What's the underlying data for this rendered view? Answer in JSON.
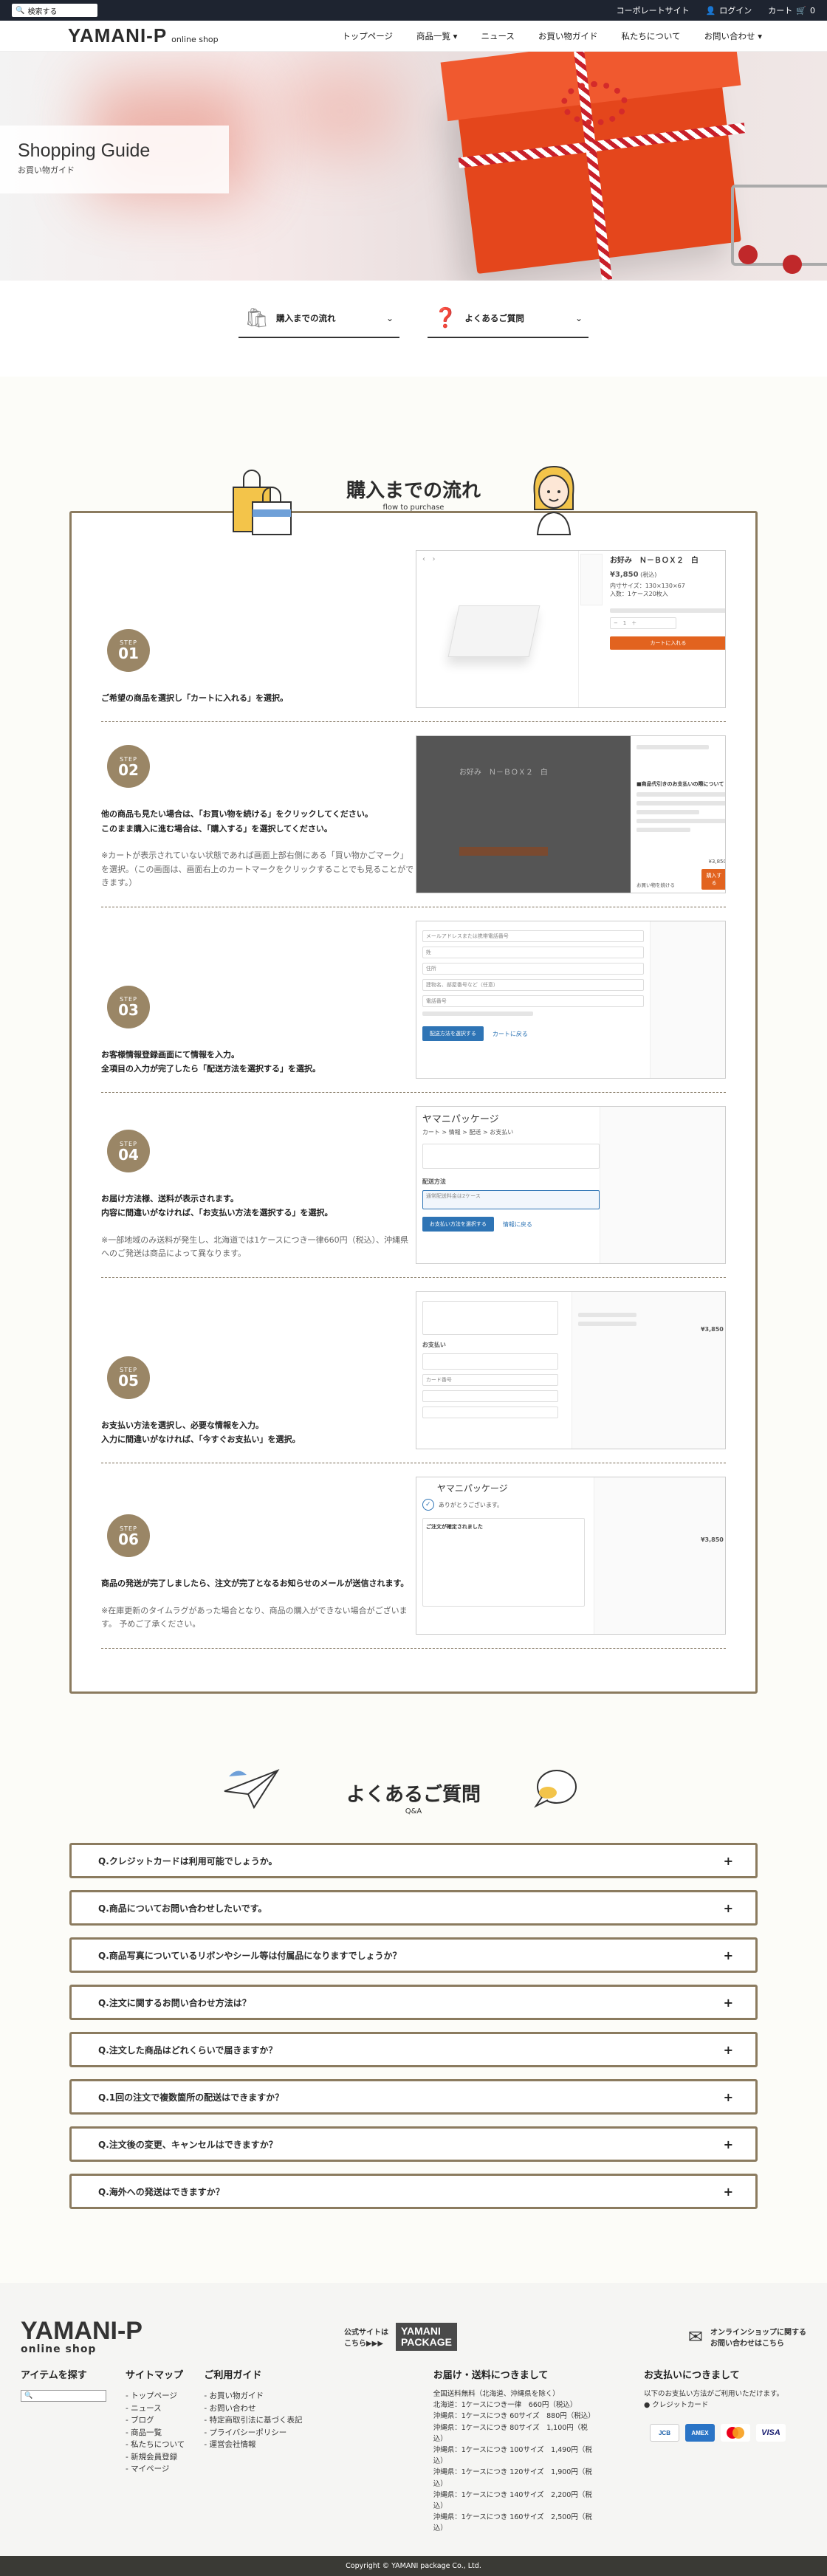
{
  "topbar": {
    "search_placeholder": "検索する",
    "corporate": "コーポレートサイト",
    "login": "ログイン",
    "cart": "カート",
    "cart_count": "0"
  },
  "header": {
    "logo": "YAMANI-P",
    "logo_sub": "online shop",
    "nav": [
      "トップページ",
      "商品一覧 ▾",
      "ニュース",
      "お買い物ガイド",
      "私たちについて",
      "お問い合わせ ▾"
    ]
  },
  "hero": {
    "title": "Shopping Guide",
    "subtitle": "お買い物ガイド"
  },
  "anchors": [
    {
      "label": "購入までの流れ"
    },
    {
      "label": "よくあるご質問"
    }
  ],
  "flow": {
    "title": "購入までの流れ",
    "title_en": "flow to purchase",
    "badge_step": "STEP",
    "steps": [
      {
        "num": "01",
        "text": "ご希望の商品を選択し「カートに入れる」を選択。",
        "note": ""
      },
      {
        "num": "02",
        "text": "他の商品も見たい場合は、「お買い物を続ける」をクリックしてください。\nこのまま購入に進む場合は、「購入する」を選択してください。",
        "note": "※カートが表示されていない状態であれば画面上部右側にある「買い物かごマーク」を選択。（この画面は、画面右上のカートマークをクリックすることでも見ることができます。）"
      },
      {
        "num": "03",
        "text": "お客様情報登録画面にて情報を入力。\n全項目の入力が完了したら「配送方法を選択する」を選択。",
        "note": ""
      },
      {
        "num": "04",
        "text": "お届け方法様、送料が表示されます。\n内容に間違いがなければ、「お支払い方法を選択する」を選択。",
        "note": "※一部地域のみ送料が発生し、北海道では1ケースにつき一律660円（税込）、沖縄県へのご発送は商品によって異なります。"
      },
      {
        "num": "05",
        "text": "お支払い方法を選択し、必要な情報を入力。\n入力に間違いがなければ、「今すぐお支払い」を選択。",
        "note": ""
      },
      {
        "num": "06",
        "text": "商品の発送が完了しましたら、注文が完了となるお知らせのメールが送信されます。",
        "note": "※在庫更新のタイムラグがあった場合となり、商品の購入ができない場合がございます。 予めご了承ください。"
      }
    ],
    "shots": {
      "product_name": "お好み　Ｎ－ＢＯＸ２　白",
      "price": "¥3,850",
      "tax": "(税込)",
      "size": "内寸サイズ：130×130×67",
      "qty_note": "入数：1ケース20枚入",
      "add_to_cart": "カートに入れる",
      "cart_title": "■商品代引きのお支払いの際について",
      "cart_total": "¥3,850",
      "buy_btn": "購入する",
      "continue": "お買い物を続ける",
      "form_email": "メールアドレスまたは携帯電話番号",
      "form_lastname": "姓",
      "form_address": "住所",
      "form_building": "建物名、部屋番号など（任意）",
      "form_phone": "電話番号",
      "to_shipping": "配送方法を選択する",
      "back_cart": "カートに戻る",
      "shop_name": "ヤマニパッケージ",
      "breadcrumb": "カート > 情報 > 配送 > お支払い",
      "ship_method": "配送方法",
      "ship_option": "通常配送料金は2ケース",
      "to_payment": "お支払い方法を選択する",
      "back_info": "情報に戻る",
      "payment": "お支払い",
      "card_number": "カード番号",
      "pay_total": "¥3,850",
      "thanks": "ありがとうございます。",
      "confirm_title": "ご注文が確定されました",
      "done_total": "¥3,850"
    }
  },
  "faq": {
    "title": "よくあるご質問",
    "title_en": "Q&A",
    "items": [
      "Q.クレジットカードは利用可能でしょうか。",
      "Q.商品についてお問い合わせしたいです。",
      "Q.商品写真についているリボンやシール等は付属品になりますでしょうか？",
      "Q.注文に関するお問い合わせ方法は？",
      "Q.注文した商品はどれくらいで届きますか？",
      "Q.1回の注文で複数箇所の配送はできますか？",
      "Q.注文後の変更、キャンセルはできますか？",
      "Q.海外への発送はできますか？"
    ],
    "plus": "+"
  },
  "footer": {
    "logo": "YAMANI-P",
    "logo_sub": "online shop",
    "official": "公式サイトは\nこちら▶▶▶",
    "pkg_logo": "YAMANI\nPACKAGE",
    "contact": "オンラインショップに関する\nお問い合わせはこちら",
    "find_title": "アイテムを探す",
    "sitemap_title": "サイトマップ",
    "sitemap": [
      "- トップページ",
      "- ニュース",
      "- ブログ",
      "- 商品一覧",
      "- 私たちについて",
      "- 新規会員登録",
      "- マイページ"
    ],
    "guide_title": "ご利用ガイド",
    "guide": [
      "- お買い物ガイド",
      "- お問い合わせ",
      "- 特定商取引法に基づく表記",
      "- プライバシーポリシー",
      "- 運営会社情報"
    ],
    "shipping_title": "お届け・送料につきまして",
    "shipping_lines": [
      "全国送料無料（北海道、沖縄県を除く）",
      "北海道：1ケースにつき一律　660円（税込）",
      "沖縄県：1ケースにつき 60サイズ　880円（税込）",
      "沖縄県：1ケースにつき 80サイズ　1,100円（税込）",
      "沖縄県：1ケースにつき 100サイズ　1,490円（税込）",
      "沖縄県：1ケースにつき 120サイズ　1,900円（税込）",
      "沖縄県：1ケースにつき 140サイズ　2,200円（税込）",
      "沖縄県：1ケースにつき 160サイズ　2,500円（税込）"
    ],
    "payment_title": "お支払いにつきまして",
    "payment_lines": [
      "以下のお支払い方法がご利用いただけます。",
      "● クレジットカード"
    ],
    "cards": [
      "JCB",
      "AMEX",
      "MC",
      "VISA"
    ],
    "copyright": "Copyright © YAMANI package Co., Ltd."
  },
  "colors": {
    "accent_brown": "#8b7b5f",
    "badge": "#9a8666",
    "topbar": "#1e2430",
    "button_blue": "#2e74b5",
    "button_orange": "#e2631f"
  }
}
